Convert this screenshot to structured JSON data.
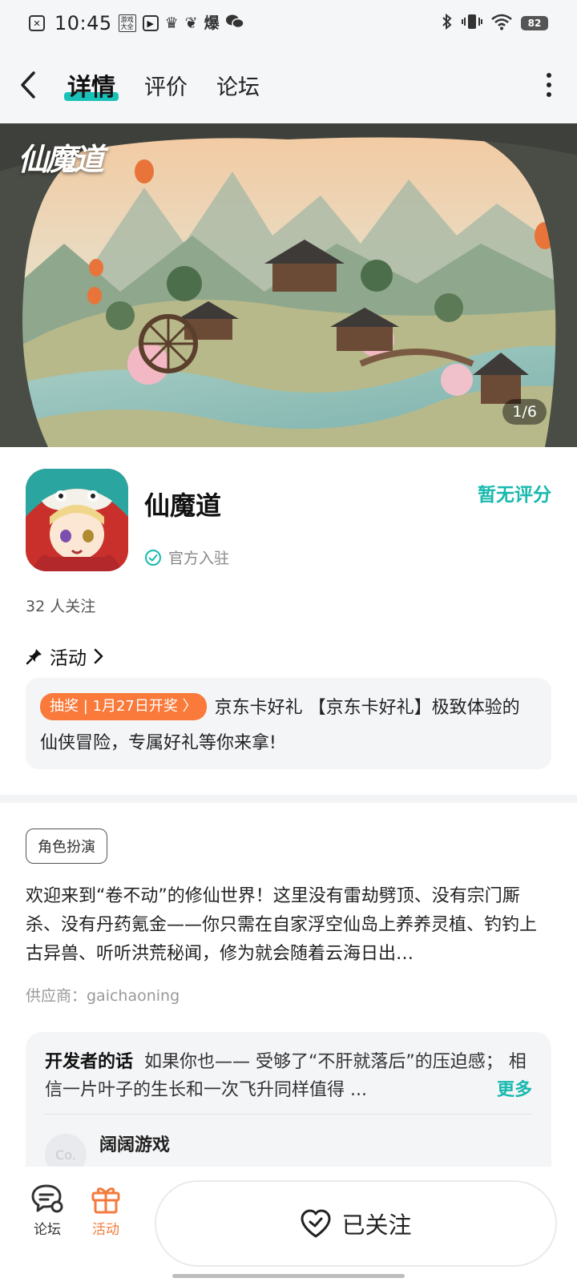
{
  "status_bar": {
    "time": "10:45",
    "battery": "82",
    "icons_left": [
      "close-square-icon",
      "game-hall-icon",
      "play-square-icon",
      "crown-icon",
      "leaf-icon",
      "explode-char-icon",
      "wechat-icon"
    ],
    "explode_char": "爆",
    "game_hall_label": "游戏大全",
    "icons_right": [
      "bluetooth-icon",
      "vibrate-icon",
      "wifi-icon",
      "battery-icon"
    ]
  },
  "nav": {
    "tabs": [
      {
        "label": "详情",
        "active": true
      },
      {
        "label": "评价",
        "active": false
      },
      {
        "label": "论坛",
        "active": false
      }
    ]
  },
  "banner": {
    "logo_text": "仙魔道",
    "counter": "1/6"
  },
  "app": {
    "name": "仙魔道",
    "official_label": "官方入驻",
    "rating_label": "暂无评分",
    "followers": "32  人关注"
  },
  "activity": {
    "header": "活动",
    "tag": "抽奖 | 1月27日开奖 〉",
    "text": "京东卡好礼  【京东卡好礼】极致体验的仙侠冒险，专属好礼等你来拿!"
  },
  "description": {
    "genre": "角色扮演",
    "intro": "欢迎来到“卷不动”的修仙世界！这里没有雷劫劈顶、没有宗门厮杀、没有丹药氪金——你只需在自家浮空仙岛上养养灵植、钓钓上古异兽、听听洪荒秘闻，修为就会随着云海日出…",
    "supplier": "供应商：gaichaoning"
  },
  "developer": {
    "title": "开发者的话",
    "text": "如果你也—— 受够了“不肝就落后”的压迫感；  相信一片叶子的生长和一次飞升同样值得 ...",
    "more_label": "更多",
    "avatar_text": "Co.",
    "name": "阔阔游戏"
  },
  "bottom_bar": {
    "forum_label": "论坛",
    "activity_label": "活动",
    "follow_label": "已关注"
  },
  "colors": {
    "accent_teal": "#18b9ae",
    "accent_orange": "#f47a3c",
    "tag_orange": "#f97a3a"
  }
}
